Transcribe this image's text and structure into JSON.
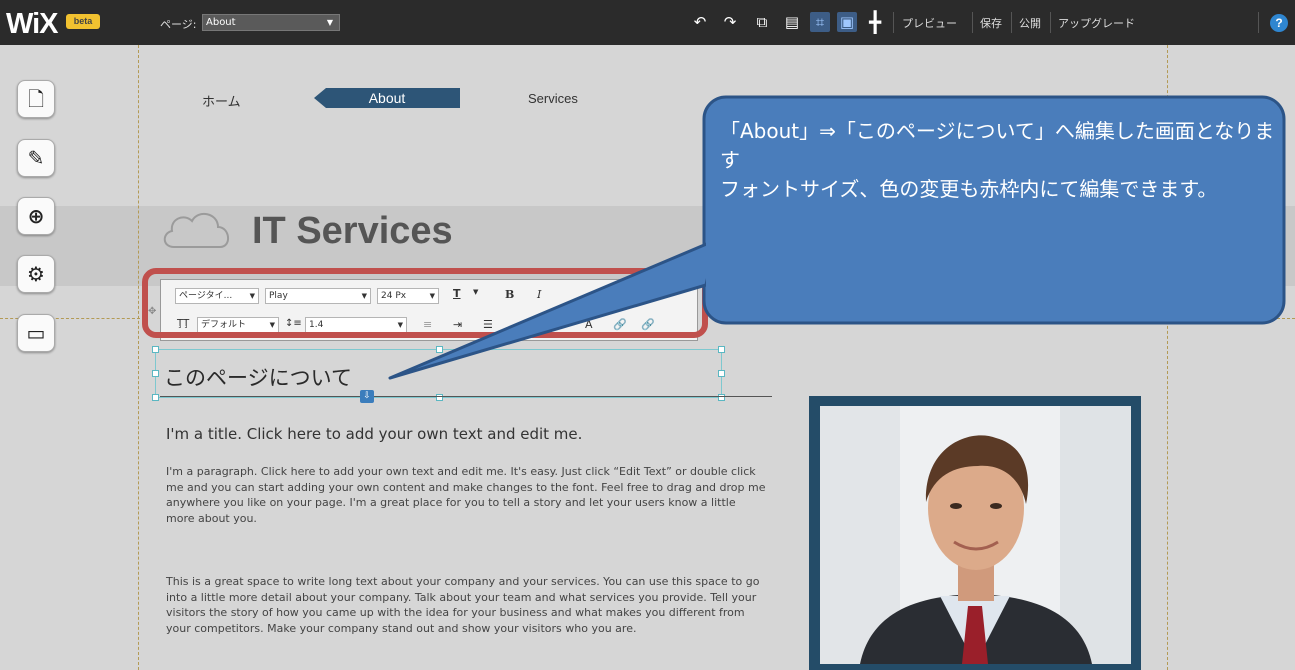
{
  "topbar": {
    "logo": "WiX",
    "beta_badge": "beta",
    "page_label": "ページ:",
    "page_select_value": "About",
    "preview": "プレビュー",
    "save": "保存",
    "publish": "公開",
    "upgrade": "アップグレード",
    "help": "?"
  },
  "site": {
    "nav": {
      "home": "ホーム",
      "about": "About",
      "services": "Services"
    },
    "title": "IT Services"
  },
  "text_toolbar": {
    "style_select": "ページタイ...",
    "font_select": "Play",
    "size_select": "24 Px",
    "bold": "B",
    "italic": "I",
    "text_color": "T",
    "spacing_select": "デフォルト",
    "line_height_select": "1.4"
  },
  "content": {
    "page_heading": "このページについて",
    "para_title": "I'm a title. Click here to add your own text and edit me.",
    "para1": "I'm a paragraph. Click here to add your own text and edit me. It's easy. Just click “Edit Text” or double click me and you can start adding your own content and make changes to the font. Feel free to drag and drop me anywhere you like on your page. I'm a great place for you to tell a story and let your users know a little more about you.",
    "para2": "This is a great space to write long text about your company and your services. You can use this space to go into a little more detail about your company. Talk about your team and what services you provide. Tell your visitors the story of how you came up with the idea for your business and what makes you different from your competitors. Make your company stand out and show your visitors who you are."
  },
  "callout": {
    "line1": "「About」⇒「このページについて」へ編集した画面となります",
    "line2": "フォントサイズ、色の変更も赤枠内にて編集できます。"
  },
  "colors": {
    "topbar": "#2b2b2b",
    "nav_active": "#2d5577",
    "callout_fill": "#4a7dbb",
    "callout_border": "#2c5487",
    "red_frame": "#c0504d",
    "photo_frame": "#244c68"
  },
  "icons": [
    "undo-icon",
    "redo-icon",
    "copy-icon",
    "paste-icon",
    "grid-icon",
    "snap-icon",
    "ruler-icon",
    "pages-icon",
    "design-brush-icon",
    "add-icon",
    "settings-gear-icon",
    "app-market-icon"
  ]
}
